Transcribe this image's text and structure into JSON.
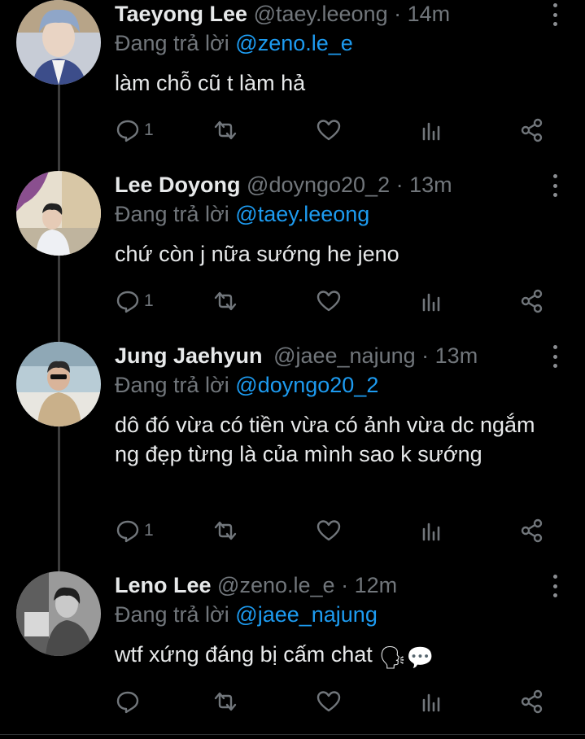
{
  "tweets": [
    {
      "name": "Taeyong Lee",
      "handle": "@taey.leeong",
      "time": "14m",
      "reply_prefix": "Đang trả lời",
      "reply_to": "@zeno.le_e",
      "text": "làm chỗ cũ t làm hả",
      "reply_count": "1",
      "avatar_color": "#8fa6c8"
    },
    {
      "name": "Lee Doyong",
      "handle": "@doyngo20_2",
      "time": "13m",
      "reply_prefix": "Đang trả lời",
      "reply_to": "@taey.leeong",
      "text": "chứ còn j nữa sướng he jeno",
      "reply_count": "1",
      "avatar_color": "#c9b89a"
    },
    {
      "name": "Jung Jaehyun",
      "handle": "@jaee_najung",
      "time": "13m",
      "reply_prefix": "Đang trả lời",
      "reply_to": "@doyngo20_2",
      "text": "dô đó vừa có tiền vừa có ảnh vừa dc ngắm ng đẹp từng là của mình sao k sướng",
      "reply_count": "1",
      "avatar_color": "#9bb3bf"
    },
    {
      "name": "Leno Lee",
      "handle": "@zeno.le_e",
      "time": "12m",
      "reply_prefix": "Đang trả lời",
      "reply_to": "@jaee_najung",
      "text": "wtf xứng đáng bị cấm chat",
      "text_emoji": "🗣💬",
      "reply_count": "",
      "avatar_color": "#6d6d6d"
    }
  ],
  "colors": {
    "background": "#000000",
    "primary_text": "#e7e9ea",
    "secondary_text": "#71767b",
    "link": "#1d9bf0",
    "thread_line": "#3d3d3d"
  },
  "icons": [
    "reply-icon",
    "retweet-icon",
    "like-icon",
    "analytics-icon",
    "share-icon",
    "more-icon"
  ]
}
